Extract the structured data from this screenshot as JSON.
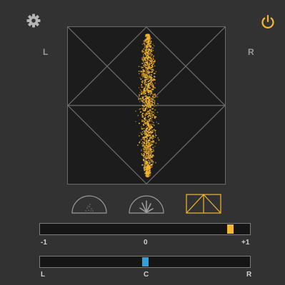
{
  "header": {
    "settings_icon": "gear-icon",
    "power_icon": "power-icon"
  },
  "scope": {
    "left_label": "L",
    "right_label": "R"
  },
  "modes": [
    "polar-dots",
    "polar-lines",
    "lissajous"
  ],
  "correlation": {
    "min_label": "-1",
    "mid_label": "0",
    "max_label": "+1",
    "value": 0.84
  },
  "balance": {
    "left_label": "L",
    "center_label": "C",
    "right_label": "R",
    "value": 0.0
  },
  "colors": {
    "accent": "#f5b731",
    "balance_indicator": "#2ea0de",
    "background": "#323232",
    "scope_background": "#1c1c1c"
  }
}
